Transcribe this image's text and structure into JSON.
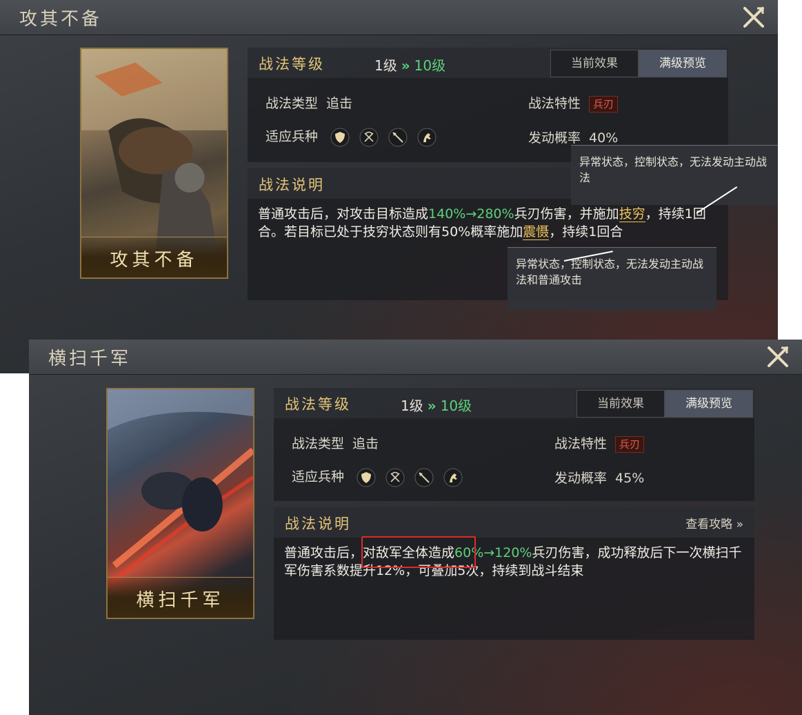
{
  "panels": [
    {
      "title": "攻其不备",
      "card_name": "攻其不备",
      "level_header": "战法等级",
      "level_from": "1级",
      "level_arrow": "»",
      "level_to": "10级",
      "tabs": [
        "当前效果",
        "满级预览"
      ],
      "active_tab": "满级预览",
      "type_label": "战法类型",
      "type_value": "追击",
      "trait_label": "战法特性",
      "trait_value": "兵刃",
      "troops_label": "适应兵种",
      "troop_icons": [
        "shield-icon",
        "bow-icon",
        "spear-icon",
        "horse-icon"
      ],
      "prob_label": "发动概率",
      "prob_value": "40%",
      "desc_header": "战法说明",
      "desc": {
        "t1": "普通攻击后，对攻击目标造成",
        "g1": "140%→280%",
        "t2": "兵刃伤害，并施加",
        "k1": "技穷",
        "t3": "，持续1回合。若目标已处于技穷状态则有50%概率施加",
        "k2": "震慑",
        "t4": "，持续1回合"
      },
      "tooltips": [
        "异常状态，控制状态，无法发动主动战法",
        "异常状态，控制状态，无法发动主动战法和普通攻击"
      ]
    },
    {
      "title": "横扫千军",
      "card_name": "横扫千军",
      "level_header": "战法等级",
      "level_from": "1级",
      "level_arrow": "»",
      "level_to": "10级",
      "tabs": [
        "当前效果",
        "满级预览"
      ],
      "active_tab": "满级预览",
      "type_label": "战法类型",
      "type_value": "追击",
      "trait_label": "战法特性",
      "trait_value": "兵刃",
      "troops_label": "适应兵种",
      "troop_icons": [
        "shield-icon",
        "bow-icon",
        "spear-icon",
        "horse-icon"
      ],
      "prob_label": "发动概率",
      "prob_value": "45%",
      "desc_header": "战法说明",
      "guide_link": "查看攻略 »",
      "desc": {
        "t1": "普通攻击后，对敌军全体造成",
        "g1": "60%→120%",
        "t2": "兵刃伤害，成功释放后下一次横扫千军伤害系数提升12%，可叠加5次，持续到战斗结束"
      }
    }
  ],
  "colors": {
    "gold_title": "#e4c57a",
    "green_value": "#5fd07c",
    "keyword": "#f0c45c",
    "trait_red": "#e05a48",
    "highlight_box": "#e02a2a"
  }
}
